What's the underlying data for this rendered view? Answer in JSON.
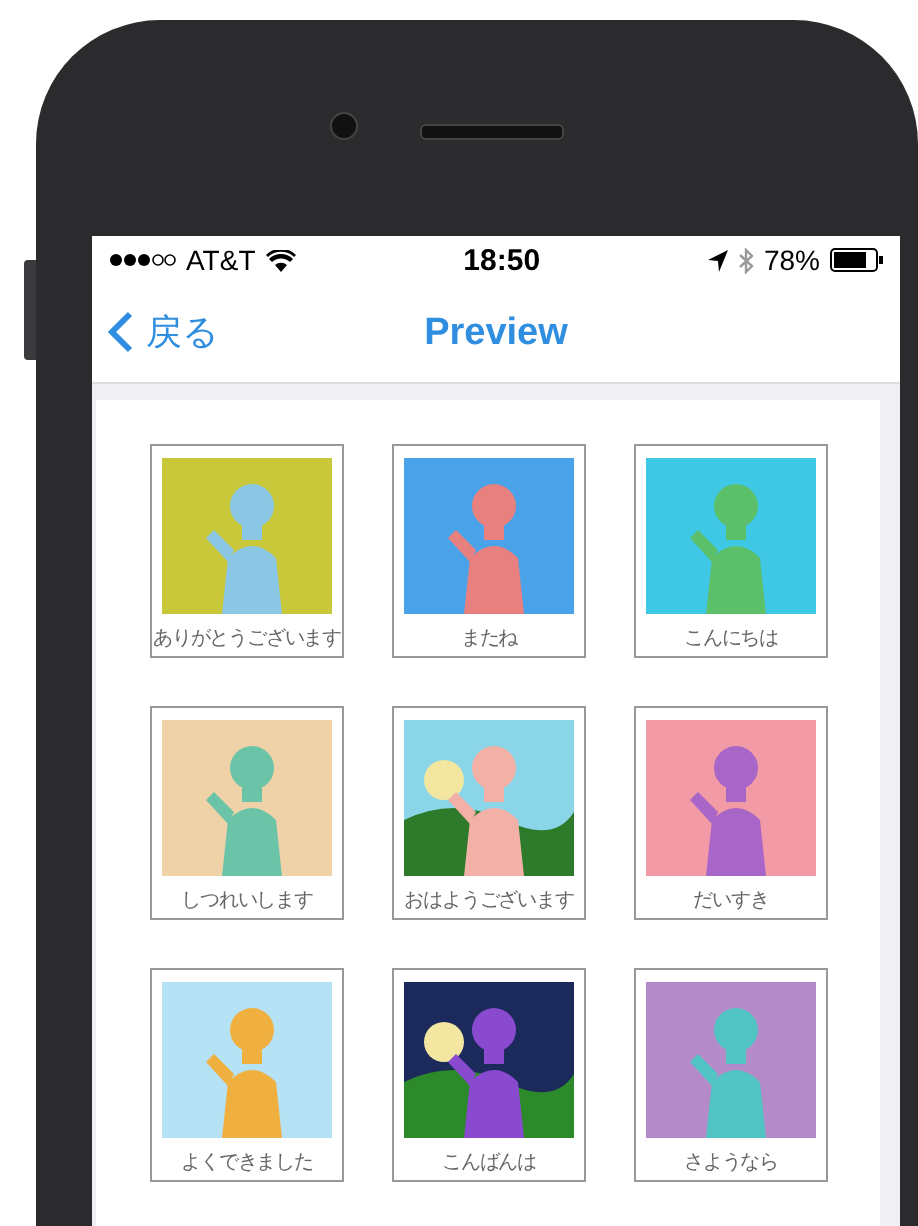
{
  "status_bar": {
    "carrier": "AT&T",
    "time": "18:50",
    "battery": "78%"
  },
  "nav_bar": {
    "back": "戻る",
    "title": "Preview"
  },
  "cards": [
    {
      "caption": "ありがとうございます",
      "kind": "picture"
    },
    {
      "caption": "またね",
      "kind": "picture"
    },
    {
      "caption": "こんにちは",
      "kind": "picture"
    },
    {
      "caption": "しつれいします",
      "kind": "picture"
    },
    {
      "caption": "おはようございます",
      "kind": "picture"
    },
    {
      "caption": "だいすき",
      "kind": "picture"
    },
    {
      "caption": "よくできました",
      "kind": "picture"
    },
    {
      "caption": "こんばんは",
      "kind": "picture"
    },
    {
      "caption": "さようなら",
      "kind": "picture"
    }
  ]
}
